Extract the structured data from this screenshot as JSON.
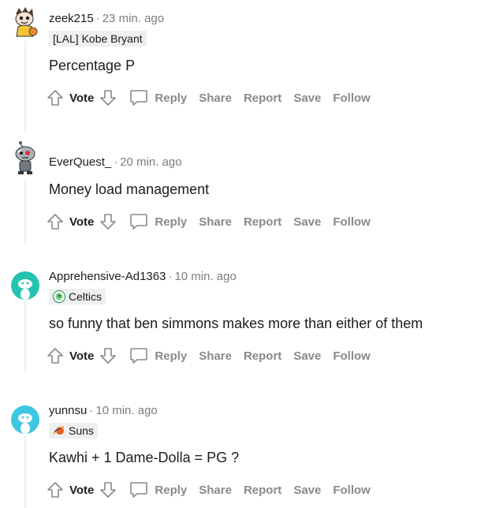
{
  "comments": [
    {
      "username": "zeek215",
      "time": "23 min. ago",
      "flair": "[LAL] Kobe Bryant",
      "body": "Percentage P",
      "actions": {
        "vote": "Vote",
        "reply": "Reply",
        "share": "Share",
        "report": "Report",
        "save": "Save",
        "follow": "Follow"
      }
    },
    {
      "username": "EverQuest_",
      "time": "20 min. ago",
      "flair": "",
      "body": "Money load management",
      "actions": {
        "vote": "Vote",
        "reply": "Reply",
        "share": "Share",
        "report": "Report",
        "save": "Save",
        "follow": "Follow"
      }
    },
    {
      "username": "Apprehensive-Ad1363",
      "time": "10 min. ago",
      "flair": "Celtics",
      "body": "so funny that ben simmons makes more than either of them",
      "actions": {
        "vote": "Vote",
        "reply": "Reply",
        "share": "Share",
        "report": "Report",
        "save": "Save",
        "follow": "Follow"
      }
    },
    {
      "username": "yunnsu",
      "time": "10 min. ago",
      "flair": "Suns",
      "body": "Kawhi + 1 Dame-Dolla = PG ?",
      "actions": {
        "vote": "Vote",
        "reply": "Reply",
        "share": "Share",
        "report": "Report",
        "save": "Save",
        "follow": "Follow"
      }
    }
  ],
  "separator": "·",
  "colors": {
    "text": "#1c1c1c",
    "muted": "#7c7c7c",
    "action": "#878a8c",
    "flair_bg": "#edeff1",
    "avatar_teal": "#24c3b0",
    "avatar_cyan": "#3ec7e0"
  }
}
